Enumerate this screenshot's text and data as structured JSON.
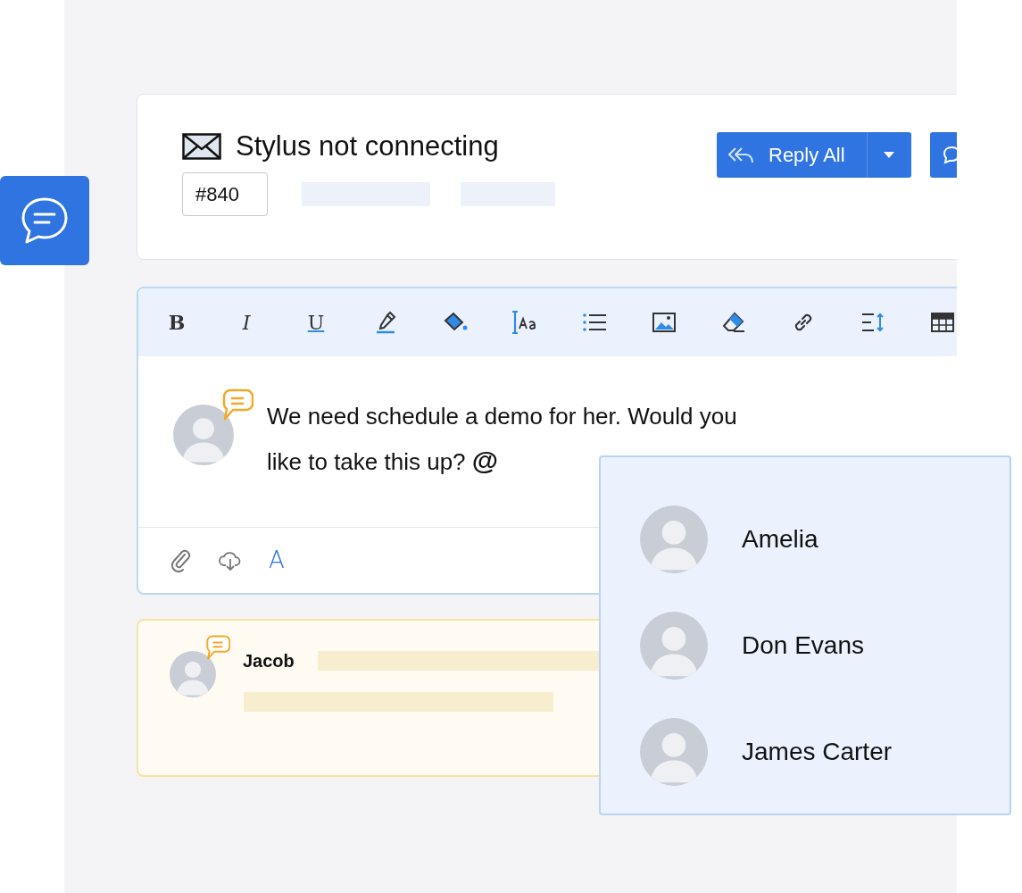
{
  "ticket": {
    "title": "Stylus not connecting",
    "number": "#840"
  },
  "reply_button": {
    "label": "Reply All"
  },
  "toolbar": [
    {
      "kind": "bold",
      "label": "B"
    },
    {
      "kind": "italic",
      "label": "I"
    },
    {
      "kind": "underline",
      "label": "U"
    },
    {
      "kind": "text-color"
    },
    {
      "kind": "fill-color"
    },
    {
      "kind": "font-size"
    },
    {
      "kind": "list"
    },
    {
      "kind": "image"
    },
    {
      "kind": "eraser"
    },
    {
      "kind": "link"
    },
    {
      "kind": "line-height"
    },
    {
      "kind": "table"
    }
  ],
  "message": {
    "text": "We need schedule a demo for her. Would you like to take this up?",
    "mention": "@"
  },
  "footer_tools": [
    {
      "kind": "attach"
    },
    {
      "kind": "cloud"
    },
    {
      "kind": "font",
      "label": "A"
    }
  ],
  "note": {
    "author": "Jacob"
  },
  "mentions": [
    {
      "name": "Amelia"
    },
    {
      "name": "Don Evans"
    },
    {
      "name": "James Carter"
    }
  ]
}
